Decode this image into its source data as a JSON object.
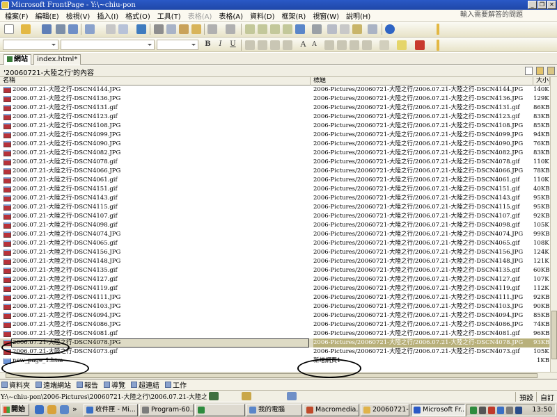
{
  "window": {
    "title": "Microsoft FrontPage - Y:\\~chiu-pon"
  },
  "menu": {
    "items": [
      {
        "label": "檔案(F)",
        "disabled": false
      },
      {
        "label": "編輯(E)",
        "disabled": false
      },
      {
        "label": "檢視(V)",
        "disabled": false
      },
      {
        "label": "插入(I)",
        "disabled": false
      },
      {
        "label": "格式(O)",
        "disabled": false
      },
      {
        "label": "工具(T)",
        "disabled": false
      },
      {
        "label": "表格(A)",
        "disabled": true
      },
      {
        "label": "表格(A)",
        "disabled": false
      },
      {
        "label": "資料(D)",
        "disabled": false
      },
      {
        "label": "框架(R)",
        "disabled": false
      },
      {
        "label": "視窗(W)",
        "disabled": false
      },
      {
        "label": "說明(H)",
        "disabled": false
      }
    ],
    "ask_placeholder": "輸入需要解答的問題"
  },
  "formatting": {
    "bold": "B",
    "italic": "I",
    "underline": "U",
    "font_size_up": "A",
    "font_size_down": "A"
  },
  "tabs": [
    {
      "label": "網站",
      "active": true
    },
    {
      "label": "index.html*",
      "active": false
    }
  ],
  "folder": {
    "title": "'20060721-大陸之行'的內容"
  },
  "columns": {
    "name": "名稱",
    "title": "標題",
    "size": "大小"
  },
  "files": [
    {
      "name": "2006.07.21-大陸之行-DSCN4144.JPG",
      "title": "2006-Pictures/20060721-大陸之行/2006.07.21-大陸之行-DSCN4144.JPG",
      "size": "140KB",
      "type": "image"
    },
    {
      "name": "2006.07.21-大陸之行-DSCN4136.JPG",
      "title": "2006-Pictures/20060721-大陸之行/2006.07.21-大陸之行-DSCN4136.JPG",
      "size": "129KB",
      "type": "image"
    },
    {
      "name": "2006.07.21-大陸之行-DSCN4131.gif",
      "title": "2006-Pictures/20060721-大陸之行/2006.07.21-大陸之行-DSCN4131.gif",
      "size": "86KB",
      "type": "image"
    },
    {
      "name": "2006.07.21-大陸之行-DSCN4123.gif",
      "title": "2006-Pictures/20060721-大陸之行/2006.07.21-大陸之行-DSCN4123.gif",
      "size": "83KB",
      "type": "image"
    },
    {
      "name": "2006.07.21-大陸之行-DSCN4108.JPG",
      "title": "2006-Pictures/20060721-大陸之行/2006.07.21-大陸之行-DSCN4108.JPG",
      "size": "85KB",
      "type": "image"
    },
    {
      "name": "2006.07.21-大陸之行-DSCN4099.JPG",
      "title": "2006-Pictures/20060721-大陸之行/2006.07.21-大陸之行-DSCN4099.JPG",
      "size": "94KB",
      "type": "image"
    },
    {
      "name": "2006.07.21-大陸之行-DSCN4090.JPG",
      "title": "2006-Pictures/20060721-大陸之行/2006.07.21-大陸之行-DSCN4090.JPG",
      "size": "76KB",
      "type": "image"
    },
    {
      "name": "2006.07.21-大陸之行-DSCN4082.JPG",
      "title": "2006-Pictures/20060721-大陸之行/2006.07.21-大陸之行-DSCN4082.JPG",
      "size": "83KB",
      "type": "image"
    },
    {
      "name": "2006.07.21-大陸之行-DSCN4078.gif",
      "title": "2006-Pictures/20060721-大陸之行/2006.07.21-大陸之行-DSCN4078.gif",
      "size": "110KB",
      "type": "image"
    },
    {
      "name": "2006.07.21-大陸之行-DSCN4066.JPG",
      "title": "2006-Pictures/20060721-大陸之行/2006.07.21-大陸之行-DSCN4066.JPG",
      "size": "78KB",
      "type": "image"
    },
    {
      "name": "2006.07.21-大陸之行-DSCN4061.gif",
      "title": "2006-Pictures/20060721-大陸之行/2006.07.21-大陸之行-DSCN4061.gif",
      "size": "110KB",
      "type": "image"
    },
    {
      "name": "2006.07.21-大陸之行-DSCN4151.gif",
      "title": "2006-Pictures/20060721-大陸之行/2006.07.21-大陸之行-DSCN4151.gif",
      "size": "40KB",
      "type": "image"
    },
    {
      "name": "2006.07.21-大陸之行-DSCN4143.gif",
      "title": "2006-Pictures/20060721-大陸之行/2006.07.21-大陸之行-DSCN4143.gif",
      "size": "95KB",
      "type": "image"
    },
    {
      "name": "2006.07.21-大陸之行-DSCN4115.gif",
      "title": "2006-Pictures/20060721-大陸之行/2006.07.21-大陸之行-DSCN4115.gif",
      "size": "95KB",
      "type": "image"
    },
    {
      "name": "2006.07.21-大陸之行-DSCN4107.gif",
      "title": "2006-Pictures/20060721-大陸之行/2006.07.21-大陸之行-DSCN4107.gif",
      "size": "92KB",
      "type": "image"
    },
    {
      "name": "2006.07.21-大陸之行-DSCN4098.gif",
      "title": "2006-Pictures/20060721-大陸之行/2006.07.21-大陸之行-DSCN4098.gif",
      "size": "105KB",
      "type": "image"
    },
    {
      "name": "2006.07.21-大陸之行-DSCN4074.JPG",
      "title": "2006-Pictures/20060721-大陸之行/2006.07.21-大陸之行-DSCN4074.JPG",
      "size": "99KB",
      "type": "image"
    },
    {
      "name": "2006.07.21-大陸之行-DSCN4065.gif",
      "title": "2006-Pictures/20060721-大陸之行/2006.07.21-大陸之行-DSCN4065.gif",
      "size": "108KB",
      "type": "image"
    },
    {
      "name": "2006.07.21-大陸之行-DSCN4156.JPG",
      "title": "2006-Pictures/20060721-大陸之行/2006.07.21-大陸之行-DSCN4156.JPG",
      "size": "124KB",
      "type": "image"
    },
    {
      "name": "2006.07.21-大陸之行-DSCN4148.JPG",
      "title": "2006-Pictures/20060721-大陸之行/2006.07.21-大陸之行-DSCN4148.JPG",
      "size": "121KB",
      "type": "image"
    },
    {
      "name": "2006.07.21-大陸之行-DSCN4135.gif",
      "title": "2006-Pictures/20060721-大陸之行/2006.07.21-大陸之行-DSCN4135.gif",
      "size": "60KB",
      "type": "image"
    },
    {
      "name": "2006.07.21-大陸之行-DSCN4127.gif",
      "title": "2006-Pictures/20060721-大陸之行/2006.07.21-大陸之行-DSCN4127.gif",
      "size": "107KB",
      "type": "image"
    },
    {
      "name": "2006.07.21-大陸之行-DSCN4119.gif",
      "title": "2006-Pictures/20060721-大陸之行/2006.07.21-大陸之行-DSCN4119.gif",
      "size": "112KB",
      "type": "image"
    },
    {
      "name": "2006.07.21-大陸之行-DSCN4111.JPG",
      "title": "2006-Pictures/20060721-大陸之行/2006.07.21-大陸之行-DSCN4111.JPG",
      "size": "92KB",
      "type": "image"
    },
    {
      "name": "2006.07.21-大陸之行-DSCN4103.JPG",
      "title": "2006-Pictures/20060721-大陸之行/2006.07.21-大陸之行-DSCN4103.JPG",
      "size": "90KB",
      "type": "image"
    },
    {
      "name": "2006.07.21-大陸之行-DSCN4094.JPG",
      "title": "2006-Pictures/20060721-大陸之行/2006.07.21-大陸之行-DSCN4094.JPG",
      "size": "85KB",
      "type": "image"
    },
    {
      "name": "2006.07.21-大陸之行-DSCN4086.JPG",
      "title": "2006-Pictures/20060721-大陸之行/2006.07.21-大陸之行-DSCN4086.JPG",
      "size": "74KB",
      "type": "image"
    },
    {
      "name": "2006.07.21-大陸之行-DSCN4081.gif",
      "title": "2006-Pictures/20060721-大陸之行/2006.07.21-大陸之行-DSCN4081.gif",
      "size": "96KB",
      "type": "image"
    },
    {
      "name": "2006.07.21-大陸之行-DSCN4078.JPG",
      "title": "2006-Pictures/20060721-大陸之行/2006.07.21-大陸之行-DSCN4078.JPG",
      "size": "93KB",
      "type": "image",
      "selected": true
    },
    {
      "name": "2006.07.21-大陸之行-DSCN4073.gif",
      "title": "2006-Pictures/20060721-大陸之行/2006.07.21-大陸之行-DSCN4073.gif",
      "size": "105KB",
      "type": "image"
    },
    {
      "name": "new_page_1.htm",
      "title": "新增網頁1",
      "size": "1KB",
      "type": "page"
    }
  ],
  "views": [
    {
      "label": "資料夾",
      "icon": "folder-icon"
    },
    {
      "label": "遠端網站",
      "icon": "remote-site-icon"
    },
    {
      "label": "報告",
      "icon": "report-icon"
    },
    {
      "label": "導覽",
      "icon": "navigation-icon"
    },
    {
      "label": "超連結",
      "icon": "hyperlink-icon"
    },
    {
      "label": "工作",
      "icon": "task-icon"
    }
  ],
  "status": {
    "path": "Y:\\~chiu-pon\\2006-Pictures\\20060721-大陸之行\\2006.07.21-大陸之行-DSCN",
    "mode": "預設",
    "custom": "自訂"
  },
  "taskbar": {
    "start": "開始",
    "more": "»",
    "buttons": [
      {
        "label": "收件匣 - Mi...",
        "color": "#3a6fc4",
        "active": false
      },
      {
        "label": "Program-60...",
        "color": "#7c7c7c",
        "active": false
      },
      {
        "label": "",
        "color": "#2e8b3e",
        "active": false
      },
      {
        "label": "我的電腦",
        "color": "#5a86c9",
        "active": false
      },
      {
        "label": "Macromedia...",
        "color": "#c04a2a",
        "active": false
      },
      {
        "label": "20060721-...",
        "color": "#e0b34a",
        "active": false
      },
      {
        "label": "Microsoft Fr...",
        "color": "#2a59c6",
        "active": true
      }
    ],
    "clock": "13:50"
  },
  "annotations": {
    "ellipse_color": "#000000"
  },
  "colors": {
    "title_bar": "#2a59c6",
    "selected_row": "#b8b07a",
    "image_file_icon": "#b8323a",
    "page_file_icon": "#6f96d8"
  }
}
